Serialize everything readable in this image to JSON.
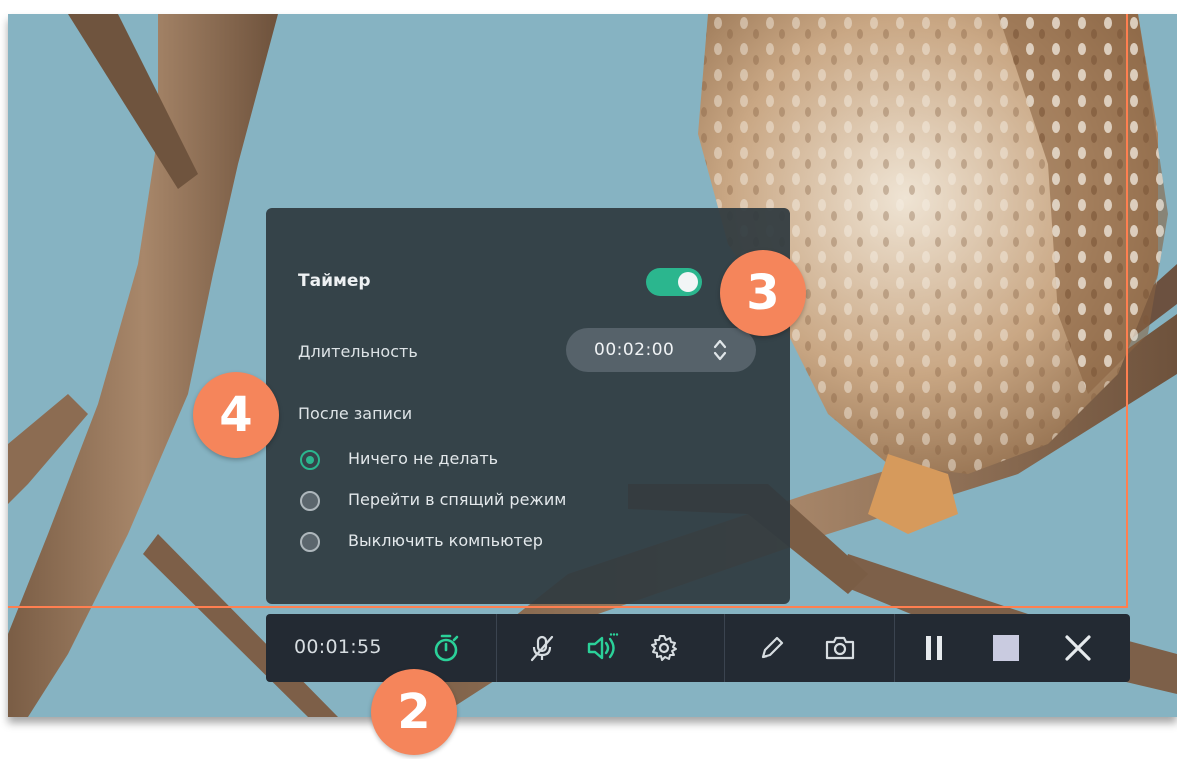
{
  "timer_panel": {
    "title": "Таймер",
    "toggle_on": true,
    "duration_label": "Длительность",
    "duration_value": "00:02:00",
    "after_recording_label": "После записи",
    "options": [
      {
        "label": "Ничего не делать",
        "selected": true
      },
      {
        "label": "Перейти в спящий режим",
        "selected": false
      },
      {
        "label": "Выключить компьютер",
        "selected": false
      }
    ]
  },
  "toolbar": {
    "elapsed_time": "00:01:55",
    "icons": [
      "timer-icon",
      "microphone-muted-icon",
      "speaker-icon",
      "settings-icon",
      "pencil-icon",
      "camera-icon",
      "pause-icon",
      "stop-icon",
      "close-icon"
    ]
  },
  "badges": {
    "toolbar_badge": "2",
    "toggle_badge": "3",
    "options_badge": "4"
  },
  "colors": {
    "accent": "#2bb68e",
    "badge": "#f5855b",
    "frame": "#ff7f50",
    "panel_bg": "#2f3a40",
    "toolbar_bg": "#232a33"
  }
}
